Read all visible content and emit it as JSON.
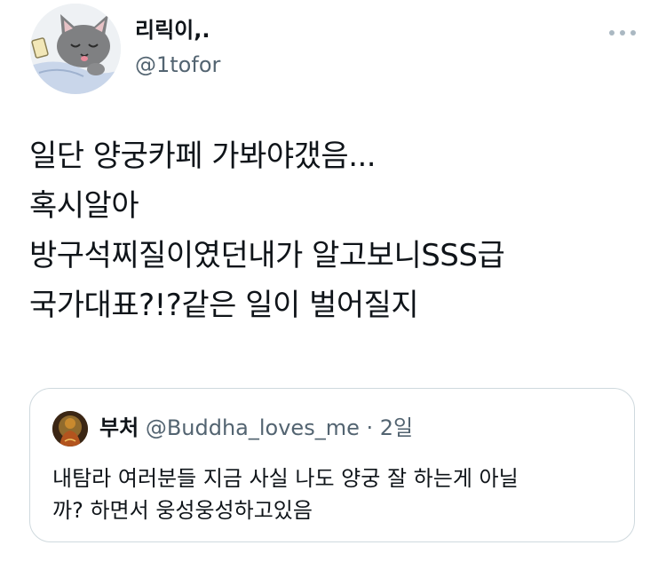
{
  "author": {
    "name": "리릭이,.",
    "handle": "@1tofor",
    "avatar_icon": "cat-sleeping-avatar-icon"
  },
  "more_icon": "more-horizontal-icon",
  "tweet": {
    "lines": [
      "일단 양궁카페 가봐야갰음...",
      "혹시알아",
      "방구석찌질이였던내가 알고보니SSS급",
      "국가대표?!?같은 일이 벌어질지"
    ]
  },
  "quote": {
    "avatar_icon": "buddha-avatar-icon",
    "name": "부처",
    "handle": "@Buddha_loves_me",
    "separator": "·",
    "time": "2일",
    "lines": [
      "내탐라 여러분들 지금 사실 나도 양궁 잘 하는게 아닐",
      "까? 하면서 웅성웅성하고있음"
    ]
  }
}
